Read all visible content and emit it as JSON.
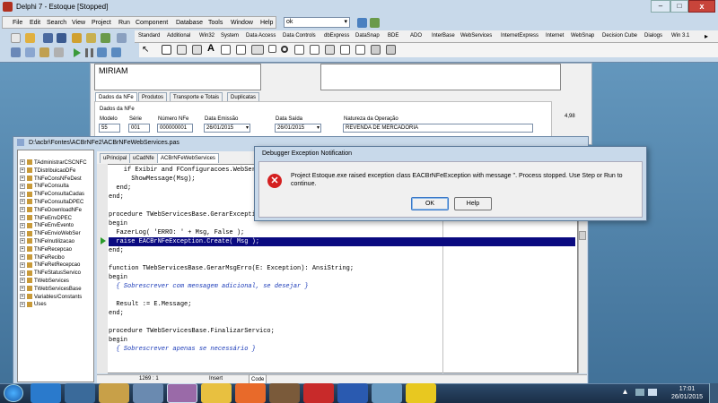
{
  "ide": {
    "title": "Delphi 7 - Estoque [Stopped]",
    "menu": [
      "File",
      "Edit",
      "Search",
      "View",
      "Project",
      "Run",
      "Component",
      "Database",
      "Tools",
      "Window",
      "Help"
    ],
    "desktop_combo": "ok",
    "palette_tabs": [
      "Standard",
      "Additional",
      "Win32",
      "System",
      "Data Access",
      "Data Controls",
      "dbExpress",
      "DataSnap",
      "BDE",
      "ADO",
      "InterBase",
      "WebServices",
      "InternetExpress",
      "Internet",
      "WebSnap",
      "Decision Cube",
      "Dialogs",
      "Win 3.1"
    ],
    "palette_more": "▸"
  },
  "form": {
    "name_value": "MIRIAM",
    "tabs": [
      "Dados da NFe",
      "Produtos",
      "Transporte e Totais",
      "Duplicatas"
    ],
    "group_title": "Dados da NFe",
    "fields": {
      "modelo_label": "Modelo",
      "modelo_value": "55",
      "serie_label": "Série",
      "serie_value": "001",
      "numero_label": "Número NFe",
      "numero_value": "000000001",
      "emissao_label": "Data Emissão",
      "emissao_value": "26/01/2015",
      "saida_label": "Data Saída",
      "saida_value": "26/01/2015",
      "natureza_label": "Natureza da Operação",
      "natureza_value": "REVENDA DE MERCADORIA"
    },
    "right_value": "4,98"
  },
  "editor": {
    "title": "D:\\acbr\\Fontes\\ACBrNFe2\\ACBrNFeWebServices.pas",
    "tabs": [
      "uPrincipal",
      "uCadNfe",
      "ACBrNFeWebServices"
    ],
    "tree": [
      "TAdministrarCSCNFC",
      "TDistribuicaoDFe",
      "TNFeConsNFeDest",
      "TNFeConsulta",
      "TNFeConsultaCadas",
      "TNFeConsultaDPEC",
      "TNFeDownloadNFe",
      "TNFeEnvDPEC",
      "TNFeEnvEvento",
      "TNFeEnvioWebSer",
      "TNFeInutilizacao",
      "TNFeRecepcao",
      "TNFeRecibo",
      "TNFeRetRecepcao",
      "TNFeStatusServico",
      "TWebServices",
      "TWebServicesBase",
      "Variables/Constants",
      "Uses"
    ],
    "code_lines": [
      {
        "t": "    if Exibir and FConfiguracoes.WebServices.Visualizar then",
        "c": "code"
      },
      {
        "t": "      ShowMessage(Msg);",
        "c": "code"
      },
      {
        "t": "  end;",
        "c": "code"
      },
      {
        "t": "end;",
        "c": "code"
      },
      {
        "t": "",
        "c": "code"
      },
      {
        "t": "procedure TWebServicesBase.GerarException(const Msg: AnsiString);",
        "c": "code"
      },
      {
        "t": "begin",
        "c": "code"
      },
      {
        "t": "  FazerLog( 'ERRO: ' + Msg, False );",
        "c": "code"
      },
      {
        "t": "  raise EACBrNFeException.Create( Msg );",
        "c": "hl"
      },
      {
        "t": "end;",
        "c": "code"
      },
      {
        "t": "",
        "c": "code"
      },
      {
        "t": "function TWebServicesBase.GerarMsgErro(E: Exception): AnsiString;",
        "c": "code"
      },
      {
        "t": "begin",
        "c": "code"
      },
      {
        "t": "  { Sobrescrever com mensagem adicional, se desejar }",
        "c": "cm"
      },
      {
        "t": "",
        "c": "code"
      },
      {
        "t": "  Result := E.Message;",
        "c": "code"
      },
      {
        "t": "end;",
        "c": "code"
      },
      {
        "t": "",
        "c": "code"
      },
      {
        "t": "procedure TWebServicesBase.FinalizarServico;",
        "c": "code"
      },
      {
        "t": "begin",
        "c": "code"
      },
      {
        "t": "  { Sobrescrever apenas se necessário }",
        "c": "cm"
      }
    ],
    "status_pos": "1269 : 1",
    "status_mode": "Insert",
    "status_tab": "Code"
  },
  "dialog": {
    "title": "Debugger Exception Notification",
    "message": "Project Estoque.exe raised exception class EACBrNFeException with message ''. Process stopped. Use Step or Run to continue.",
    "ok_label": "OK",
    "help_label": "Help"
  },
  "taskbar": {
    "time": "17:01",
    "date": "26/01/2015"
  },
  "window_controls": {
    "minimize": "–",
    "maximize": "□",
    "close": "x"
  },
  "colors": {
    "selection": "#0a0a80",
    "close_red": "#c8443a",
    "error_red": "#d42020"
  }
}
